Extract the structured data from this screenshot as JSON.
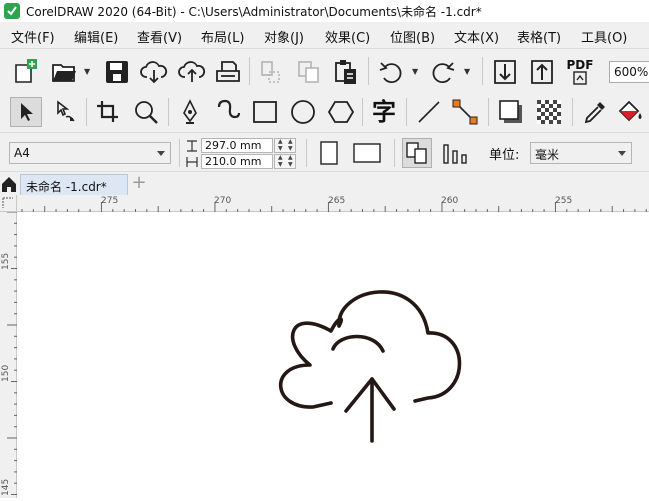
{
  "window": {
    "title": "CorelDRAW 2020 (64-Bit) - C:\\Users\\Administrator\\Documents\\未命名 -1.cdr*"
  },
  "menu": [
    "文件(F)",
    "编辑(E)",
    "查看(V)",
    "布局(L)",
    "对象(J)",
    "效果(C)",
    "位图(B)",
    "文本(X)",
    "表格(T)",
    "工具(O)"
  ],
  "std_toolbar": {
    "icons": [
      "new-document-icon",
      "open-icon",
      "save-icon",
      "cloud-download-icon",
      "cloud-upload-icon",
      "print-icon",
      "cut-icon",
      "copy-icon",
      "paste-icon",
      "undo-icon",
      "redo-icon",
      "import-icon",
      "export-icon",
      "pdf-icon"
    ],
    "pdf_label": "PDF",
    "zoom": "600%"
  },
  "tool_toolbar": {
    "icons": [
      "pick-tool-icon",
      "shape-tool-icon",
      "crop-tool-icon",
      "zoom-tool-icon",
      "pen-tool-icon",
      "artistic-media-icon",
      "rectangle-tool-icon",
      "ellipse-tool-icon",
      "polygon-tool-icon",
      "text-tool-icon",
      "line-tool-icon",
      "connector-tool-icon",
      "drop-shadow-icon",
      "transparency-icon",
      "eyedropper-icon",
      "fill-tool-icon"
    ],
    "text_tool_glyph": "字"
  },
  "property_bar": {
    "page_size": "A4",
    "width": "297.0 mm",
    "height": "210.0 mm",
    "units_label": "单位:",
    "units_value": "毫米"
  },
  "tabs": {
    "document": "未命名 -1.cdr*",
    "new_tab": "+"
  },
  "rulers": {
    "horizontal": [
      "275",
      "270",
      "265",
      "260",
      "255"
    ],
    "vertical": [
      "155",
      "150",
      "145"
    ]
  },
  "colors": {
    "accent": "#2a6cc9",
    "drawing_stroke": "#231815",
    "app_icon_green": "#2ea44f"
  }
}
